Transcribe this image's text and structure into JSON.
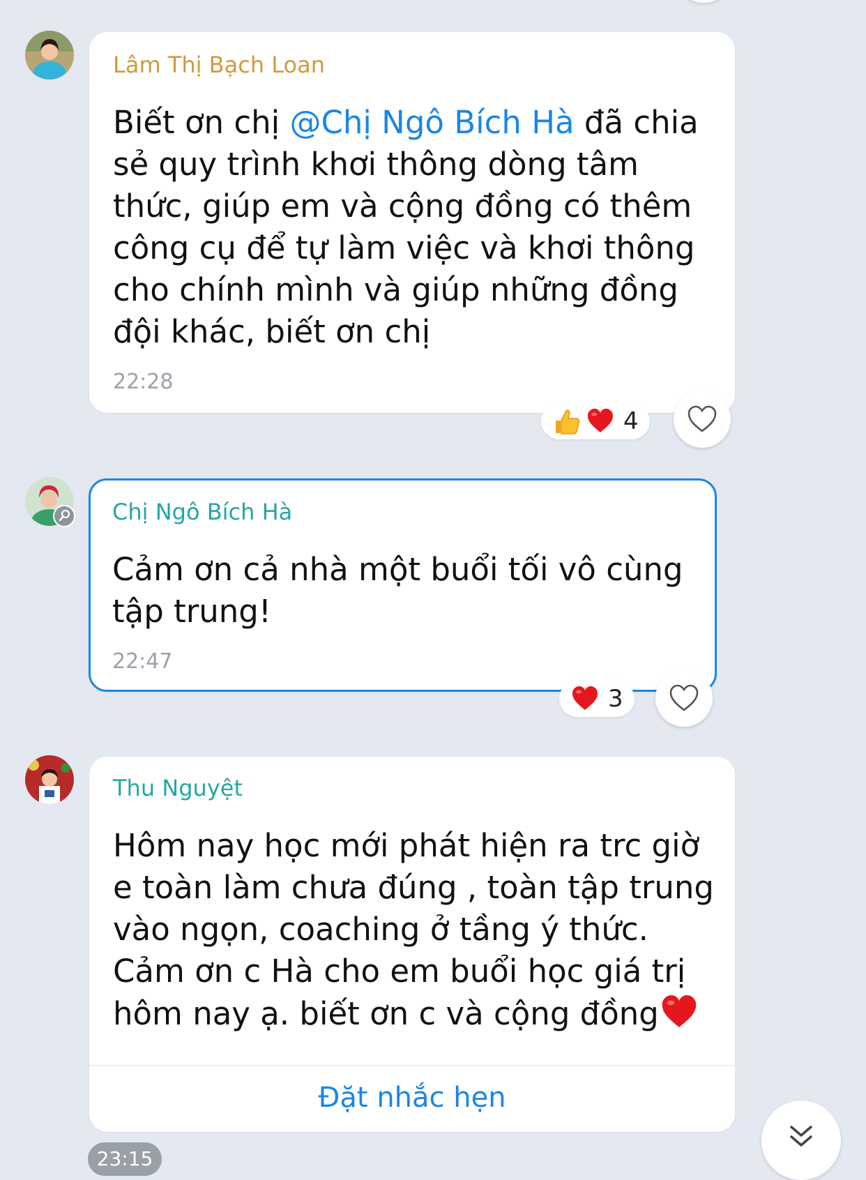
{
  "colors": {
    "background": "#e3e8f1",
    "sender_loan": "#d19a3a",
    "sender_teal": "#25a6a6",
    "mention": "#1a86e6",
    "accent": "#1a86e6",
    "timestamp": "#9aa1aa"
  },
  "messages": [
    {
      "sender": "Lâm Thị Bạch Loan",
      "lines": [
        {
          "before": "Biết ơn chị ",
          "mention": "@Chị Ngô Bích Hà",
          "after": " đã chia"
        },
        {
          "text": "sẻ quy trình khơi thông dòng tâm"
        },
        {
          "text": "thức, giúp em và cộng đồng có thêm"
        },
        {
          "text": "công cụ để tự làm việc và khơi thông"
        },
        {
          "text": "cho chính mình và giúp những đồng"
        },
        {
          "text": "đội khác,  biết ơn chị"
        }
      ],
      "time": "22:28",
      "reactions": {
        "emojis": [
          "thumbs-up",
          "red-heart"
        ],
        "count": "4"
      }
    },
    {
      "sender": "Chị Ngô Bích Hà",
      "lines": [
        {
          "text": "Cảm ơn cả nhà một buổi tối vô cùng"
        },
        {
          "text": "tập trung!"
        }
      ],
      "time": "22:47",
      "reactions": {
        "emojis": [
          "red-heart"
        ],
        "count": "3"
      }
    },
    {
      "sender": "Thu Nguyệt",
      "lines": [
        {
          "text": "Hôm nay học mới phát hiện ra trc giờ"
        },
        {
          "text": "e toàn làm chưa đúng , toàn tập trung"
        },
        {
          "text": "vào ngọn, coaching ở tầng  ý thức."
        },
        {
          "text": "Cảm ơn c Hà cho em buổi học giá trị"
        },
        {
          "text": "hôm nay ạ. biết ơn c và cộng đồng"
        }
      ],
      "action": "Đặt nhắc hẹn",
      "time": "23:15"
    }
  ],
  "icons": {
    "react": "heart-outline-icon",
    "scroll": "double-chevron-down-icon"
  }
}
